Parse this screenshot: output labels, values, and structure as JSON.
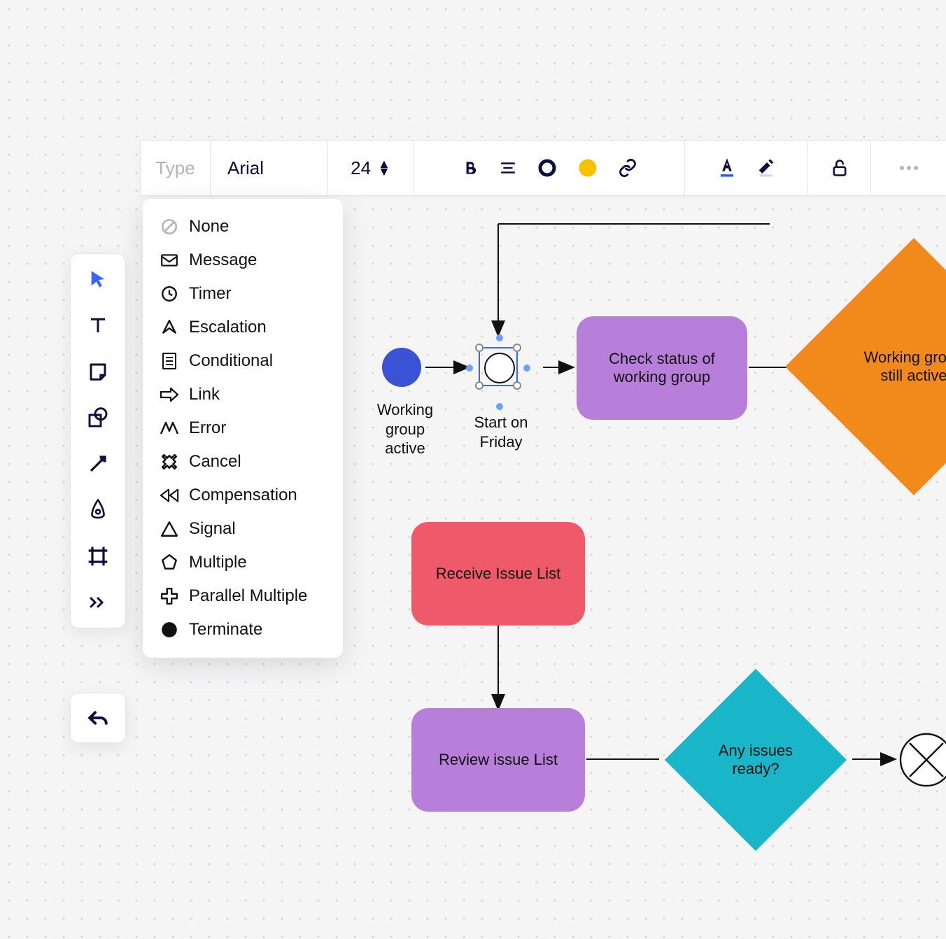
{
  "toolbar": {
    "type_label": "Type",
    "font_name": "Arial",
    "font_size": "24"
  },
  "dropdown": {
    "items": [
      "None",
      "Message",
      "Timer",
      "Escalation",
      "Conditional",
      "Link",
      "Error",
      "Cancel",
      "Compensation",
      "Signal",
      "Multiple",
      "Parallel Multiple",
      "Terminate"
    ]
  },
  "diagram": {
    "start_label": "Working group active",
    "timer_label": "Start on Friday",
    "check_status": "Check status of working group",
    "still_active": "Working group still active",
    "receive_list": "Receive Issue List",
    "review_list": "Review issue List",
    "any_issues": "Any issues ready?"
  },
  "colors": {
    "blue": "#3a52d6",
    "purple": "#b77fd9",
    "orange": "#f28a1b",
    "pink": "#ee5a6a",
    "cyan": "#19b6c9",
    "dark": "#0d0d40",
    "yellow": "#f7c200"
  }
}
